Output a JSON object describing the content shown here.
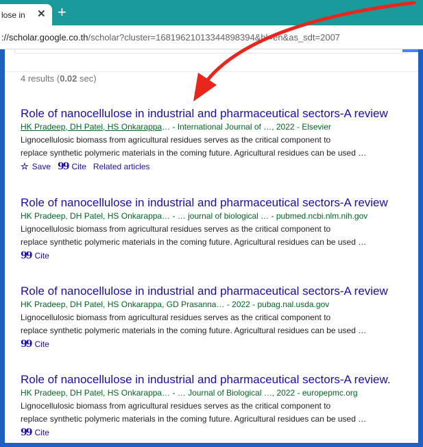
{
  "browser": {
    "tab_title": "lose in",
    "close_symbol": "✕",
    "new_tab_symbol": "+",
    "url_prefix": "://scholar.google.co.th",
    "url_rest": "/scholar?cluster=16819621013344898394&hl=en&as_sdt=2007"
  },
  "colors": {
    "tab_strip": "#1a9a9a",
    "title_link": "#1a0dab",
    "meta_green": "#006621",
    "frame_blue": "#1f5fc4",
    "annotation_arrow": "#e8261e"
  },
  "results_count": {
    "prefix": "4 results (",
    "time": "0.02",
    "suffix": " sec)"
  },
  "results": [
    {
      "title": "Role of nanocellulose in industrial and pharmaceutical sectors-A review",
      "authors_linked": "HK Pradeep, DH Patel, HS Onkarappa",
      "meta_rest": "… - International Journal of …, 2022 - Elsevier",
      "snippet_1": "Lignocellulosic biomass from agricultural residues serves as the critical component to",
      "snippet_2": "replace synthetic polymeric materials in the coming future. Agricultural residues can be used …",
      "save_label": "Save",
      "cite_label": "Cite",
      "related_label": "Related articles"
    },
    {
      "title": "Role of nanocellulose in industrial and pharmaceutical sectors-A review",
      "meta": "HK Pradeep, DH Patel, HS Onkarappa… - … journal of biological … - pubmed.ncbi.nlm.nih.gov",
      "snippet_1": "Lignocellulosic biomass from agricultural residues serves as the critical component to",
      "snippet_2": "replace synthetic polymeric materials in the coming future. Agricultural residues can be used …",
      "cite_label": "Cite"
    },
    {
      "title": "Role of nanocellulose in industrial and pharmaceutical sectors-A review",
      "meta": "HK Pradeep, DH Patel, HS Onkarappa, GD Prasanna… - 2022 - pubag.nal.usda.gov",
      "snippet_1": "Lignocellulosic biomass from agricultural residues serves as the critical component to",
      "snippet_2": "replace synthetic polymeric materials in the coming future. Agricultural residues can be used …",
      "cite_label": "Cite"
    },
    {
      "title": "Role of nanocellulose in industrial and pharmaceutical sectors-A review.",
      "meta": "HK Pradeep, DH Patel, HS Onkarappa… - … Journal of Biological …, 2022 - europepmc.org",
      "snippet_1": "Lignocellulosic biomass from agricultural residues serves as the critical component to",
      "snippet_2": "replace synthetic polymeric materials in the coming future. Agricultural residues can be used …",
      "cite_label": "Cite"
    }
  ],
  "icons": {
    "star": "☆",
    "quote": "99"
  }
}
